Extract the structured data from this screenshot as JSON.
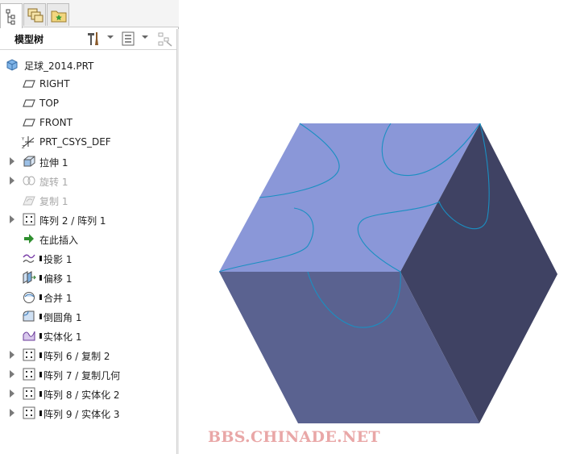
{
  "panel": {
    "tabs": [
      {
        "name": "model-tree-tab",
        "icon": "tree-icon"
      },
      {
        "name": "layers-tab",
        "icon": "layers-icon"
      },
      {
        "name": "favorites-tab",
        "icon": "folder-star-icon"
      }
    ],
    "title": "模型树",
    "toolbar_icons": [
      "settings-tools-icon",
      "tree-filter-icon",
      "show-columns-icon"
    ]
  },
  "tree": {
    "root": "足球_2014.PRT",
    "items": [
      {
        "label": "RIGHT",
        "icon": "datum-plane-icon"
      },
      {
        "label": "TOP",
        "icon": "datum-plane-icon"
      },
      {
        "label": "FRONT",
        "icon": "datum-plane-icon"
      },
      {
        "label": "PRT_CSYS_DEF",
        "icon": "coordinate-system-icon"
      },
      {
        "label": "拉伸 1",
        "icon": "extrude-icon"
      },
      {
        "label": "旋转 1",
        "icon": "revolve-icon"
      },
      {
        "label": "复制 1",
        "icon": "copy-icon"
      },
      {
        "label": "阵列 2 / 阵列 1",
        "icon": "pattern-icon"
      },
      {
        "label": "在此插入",
        "icon": "insert-here-icon"
      },
      {
        "label": "投影 1",
        "icon": "project-icon"
      },
      {
        "label": "偏移 1",
        "icon": "offset-icon"
      },
      {
        "label": "合并 1",
        "icon": "merge-icon"
      },
      {
        "label": "倒圆角 1",
        "icon": "round-icon"
      },
      {
        "label": "实体化 1",
        "icon": "solidify-icon"
      },
      {
        "label": "阵列 6 / 复制 2",
        "icon": "pattern-icon"
      },
      {
        "label": "阵列 7 / 复制几何",
        "icon": "pattern-icon"
      },
      {
        "label": "阵列 8 / 实体化 2",
        "icon": "pattern-icon"
      },
      {
        "label": "阵列 9 / 实体化 3",
        "icon": "pattern-icon"
      }
    ]
  },
  "colors": {
    "top_face": "#8a97d8",
    "right_face": "#3f4263",
    "front_face": "#5a6290",
    "curve": "#1a8fc2"
  },
  "watermark": "BBS.CHINADE.NET"
}
